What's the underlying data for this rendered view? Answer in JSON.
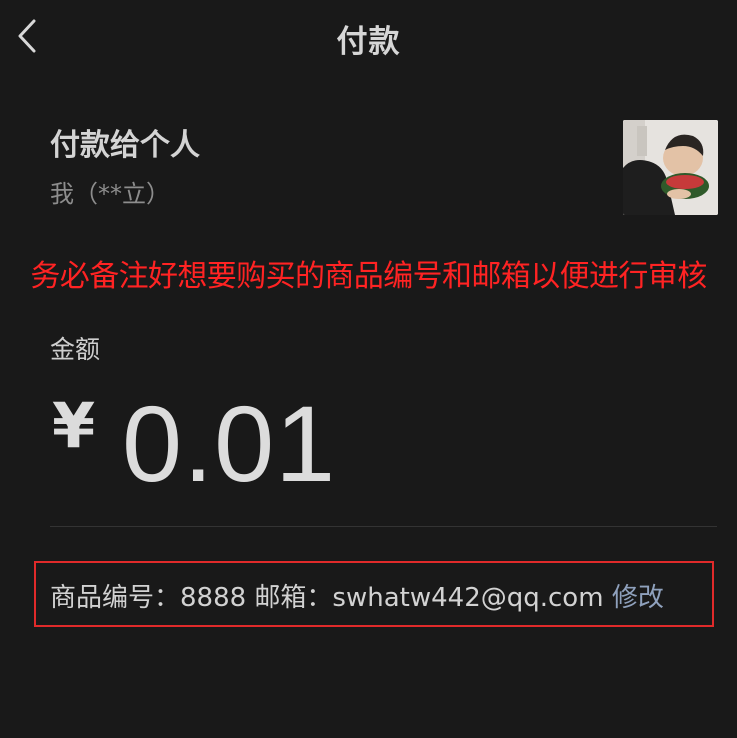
{
  "header": {
    "title": "付款",
    "back_icon": "chevron-left-icon"
  },
  "payee": {
    "title": "付款给个人",
    "subtitle": "我（**立）",
    "avatar_icon": "profile-photo"
  },
  "notice": {
    "text": "务必备注好想要购买的商品编号和邮箱以便进行审核",
    "color": "#ff2323"
  },
  "amount": {
    "label": "金额",
    "currency": "¥",
    "value": "0.01"
  },
  "remark": {
    "text": "商品编号：8888 邮箱：swhatw442@qq.com",
    "edit_label": "修改",
    "border_color": "#e02a2a"
  }
}
